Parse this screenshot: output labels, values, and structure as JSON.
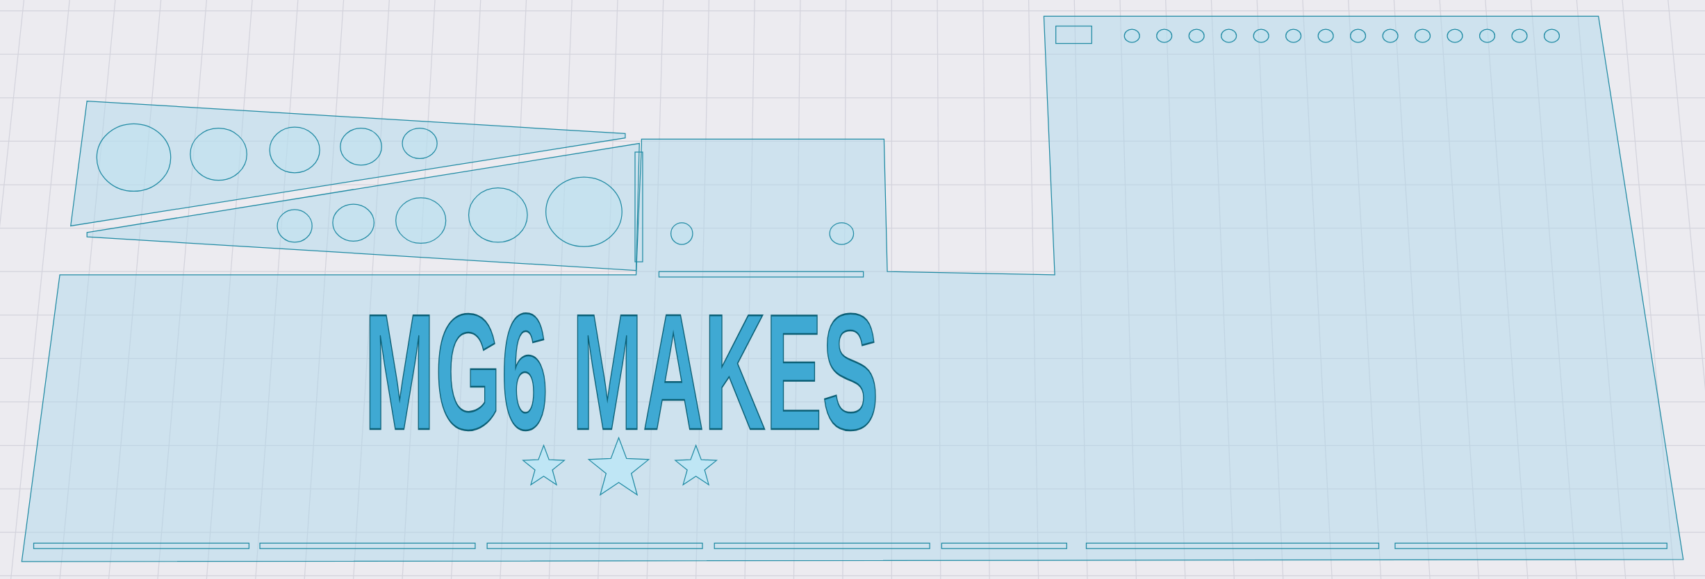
{
  "engraving": {
    "text": "MG6 MAKES"
  }
}
